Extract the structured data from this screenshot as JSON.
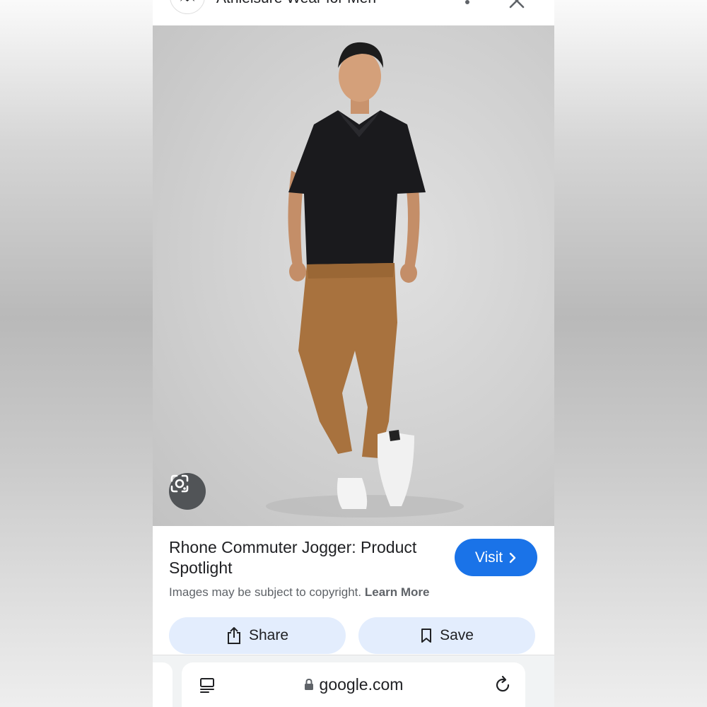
{
  "header": {
    "title": "Athleisure Wear for Men"
  },
  "result": {
    "title": "Rhone Commuter Jogger: Product Spotlight",
    "visit_label": "Visit",
    "copyright_text": "Images may be subject to copyright.",
    "learn_more_label": "Learn More",
    "share_label": "Share",
    "save_label": "Save"
  },
  "browser": {
    "url": "google.com"
  },
  "colors": {
    "accent": "#1a73e8",
    "pill_bg": "#e3edfd"
  }
}
